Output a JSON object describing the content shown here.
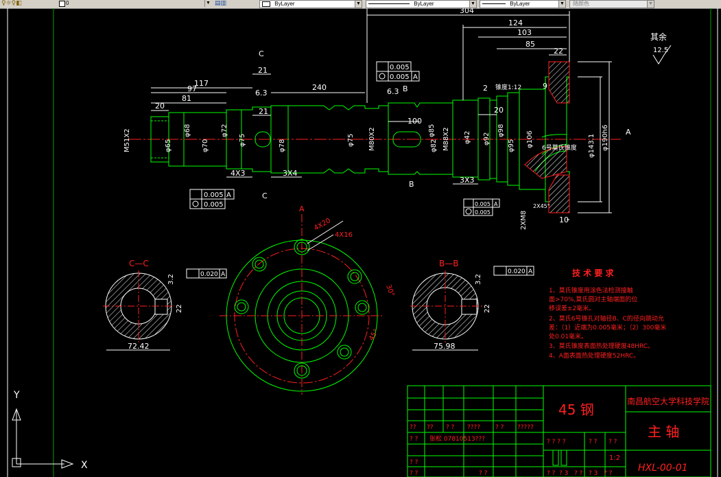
{
  "toolbar": {
    "layer_value": "0",
    "color_value": "ByLayer",
    "linetype_value": "ByLayer",
    "lineweight_value": "ByLayer",
    "plotstyle_value": "随颜色"
  },
  "drawing": {
    "dims": {
      "d304": "304",
      "d124": "124",
      "d103": "103",
      "d85": "85",
      "d22": "22",
      "d117": "117",
      "d97": "97",
      "d81": "81",
      "d20a": "20",
      "d240": "240",
      "d21a": "21",
      "d21b": "21",
      "d100": "100",
      "d20b": "20",
      "d9": "9",
      "d2": "2",
      "d20c": "20",
      "d10": "10"
    },
    "diameters": {
      "m51": "M51X2",
      "d65": "φ65",
      "d68": "φ68",
      "d70": "φ70",
      "d72": "φ72",
      "d75a": "φ75",
      "d78": "φ78",
      "d75b": "φ75",
      "m80": "M80X2",
      "d82": "φ82",
      "d85": "φ85",
      "m88": "M88X2",
      "d42": "φ42",
      "d92": "φ92",
      "d95": "φ95",
      "d98": "φ98",
      "d106": "φ106",
      "d143": "φ143.1",
      "d190": "φ190h6"
    },
    "labels": {
      "chamfer_4x3": "4X3",
      "chamfer_3x4": "3X4",
      "chamfer_3x3": "3X3",
      "finish_63a": "6.3",
      "finish_63b": "6.3",
      "taper": "锥度1:12",
      "morse": "6号莫氏锥度",
      "angle": "2X45°",
      "thread_m8": "2XM8",
      "section_c_top": "C",
      "section_c_bot": "C",
      "section_b_top": "B",
      "section_b_bot": "B",
      "datum_a": "A"
    },
    "tolerances": {
      "t1_val": "0.005",
      "t1_ref": "A",
      "t2_val": "0.005",
      "t2_ref": "A",
      "t3_val": "0.005",
      "t3_ref": "A",
      "t4_val": "0.005",
      "t5_val": "0.005",
      "t5_ref": "A",
      "t6_val": "0.005"
    },
    "surface": {
      "label": "其余",
      "value": "12.5"
    },
    "section_cc": {
      "title": "C—C",
      "width": "72.42",
      "key": "22",
      "finish": "3.2",
      "tol": "0.020",
      "ref": "A"
    },
    "section_bb": {
      "title": "B—B",
      "width": "75.98",
      "key": "22",
      "finish": "3.2",
      "tol": "0.020",
      "ref": "A"
    },
    "flange": {
      "label_a": "A",
      "holes_a": "4X16",
      "holes_b": "4X20",
      "angle_a": "30°",
      "angle_b": "45°"
    },
    "notes": {
      "title": "技 术 要 求",
      "lines": [
        "1、莫氏锥度用涂色法检测接触",
        "面>70%,莫氏圆对主轴端面的位",
        "移误差±2毫米。",
        "2、莫氏6号锥孔对轴径B、C的径向跳动允",
        "差：（1）近端为0.005毫米；（2）300毫米",
        "处0.01毫米。",
        "3、莫氏锥度表面热处理硬度48HRC。",
        "4、A面表面热处理硬度52HRC。"
      ]
    },
    "title_block": {
      "material": "45  钢",
      "school": "南昌航空大学科技学院",
      "part": "主 轴",
      "drawing_no": "HXL-00-01",
      "scale": "1:2",
      "row1": [
        "??",
        "??",
        "? ?",
        "????",
        "? ?",
        "?????"
      ],
      "row2_a": "? ?",
      "row2_b": "张松 07810513???",
      "row3": [
        "? ? ? ?",
        "? ?",
        "? ?"
      ],
      "row4": [
        "? ?"
      ],
      "row5": [
        "? ?",
        "? ?",
        "? ?",
        "? 3",
        "? ?",
        "? 3",
        "? ?"
      ]
    },
    "ucs": {
      "x": "X",
      "y": "Y"
    }
  }
}
